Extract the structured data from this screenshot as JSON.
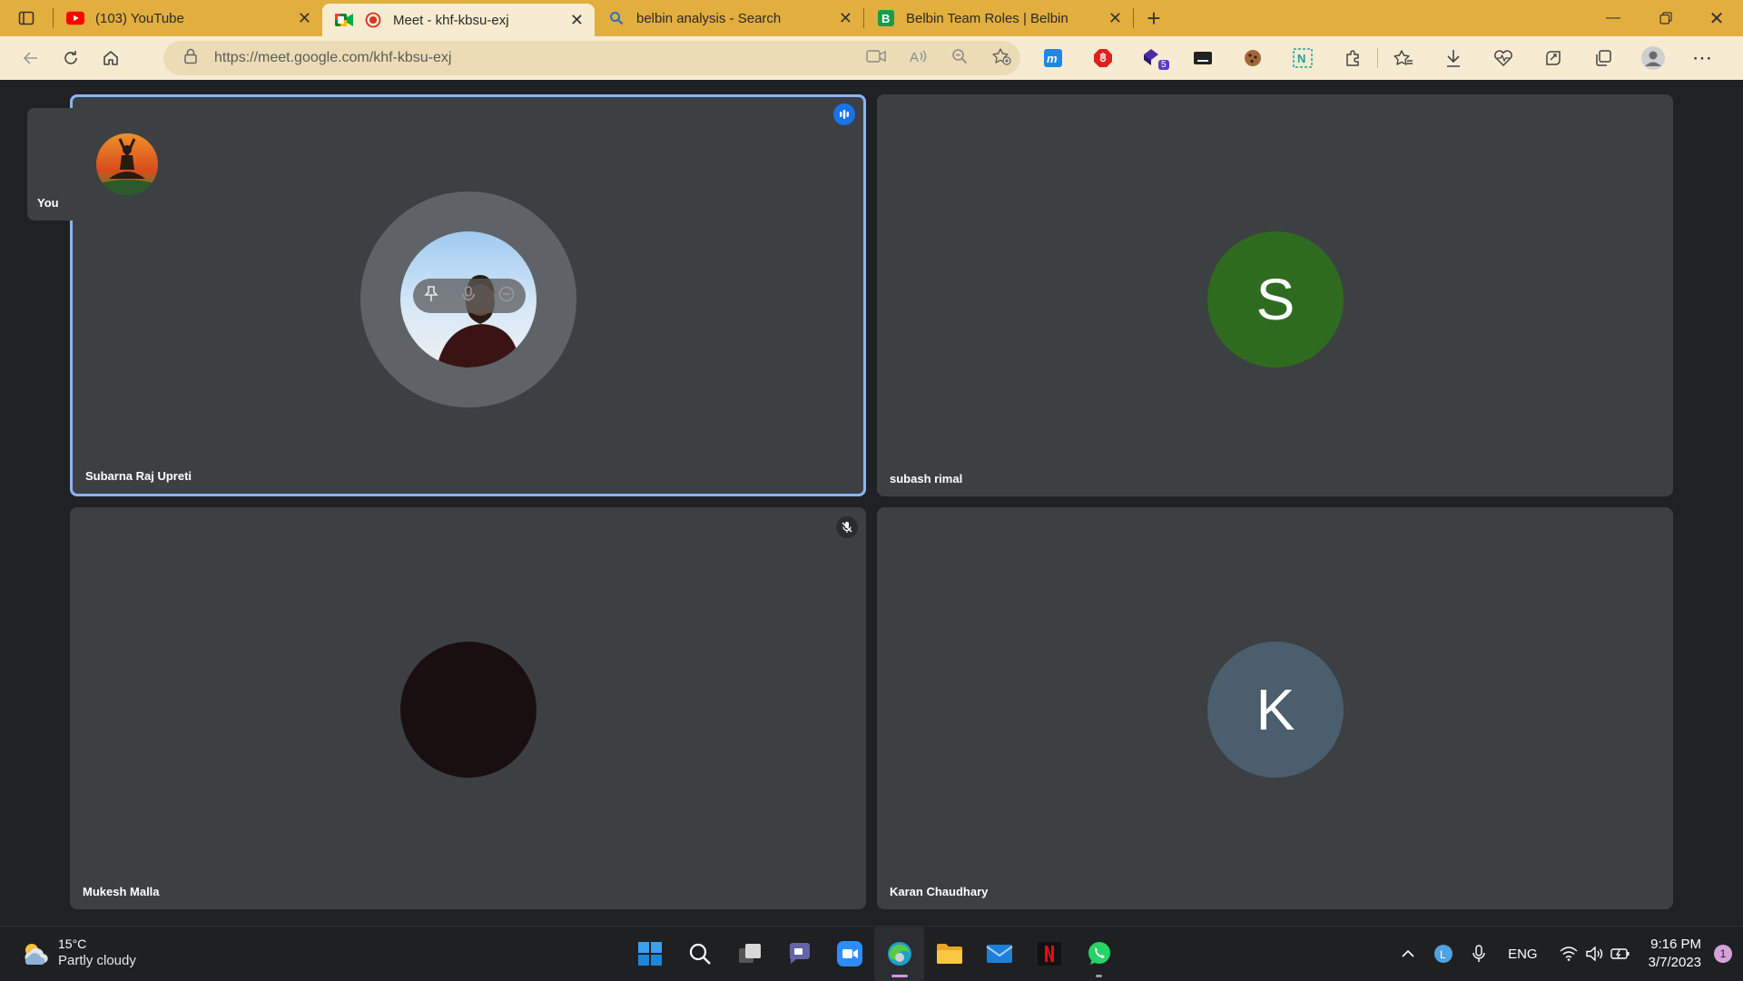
{
  "browser": {
    "tabs": [
      {
        "label": "(103) YouTube",
        "icon": "youtube-icon"
      },
      {
        "label": "Meet - khf-kbsu-exj",
        "icon": "google-meet-icon",
        "active": true,
        "recording": true
      },
      {
        "label": "belbin analysis - Search",
        "icon": "search-icon"
      },
      {
        "label": "Belbin Team Roles | Belbin",
        "icon": "belbin-icon"
      }
    ],
    "url": "https://meet.google.com/khf-kbsu-exj",
    "colors": {
      "tabbar": "#e2ae3e",
      "toolbar": "#f7ecd1"
    }
  },
  "meet": {
    "self_label": "You",
    "participants": [
      {
        "name": "Subarna Raj Upreti",
        "speaking": true,
        "avatar": "photo"
      },
      {
        "name": "subash rimal",
        "avatar_letter": "S",
        "avatar_color": "#2f6b1f"
      },
      {
        "name": "Mukesh Malla",
        "muted": true,
        "avatar": "dark-photo"
      },
      {
        "name": "Karan Chaudhary",
        "avatar_letter": "K",
        "avatar_color": "#4a5e6d"
      }
    ]
  },
  "taskbar": {
    "weather_temp": "15°C",
    "weather_desc": "Partly cloudy",
    "language": "ENG",
    "time": "9:16 PM",
    "date": "3/7/2023",
    "notification_count": "1",
    "extension_badge": "5"
  }
}
